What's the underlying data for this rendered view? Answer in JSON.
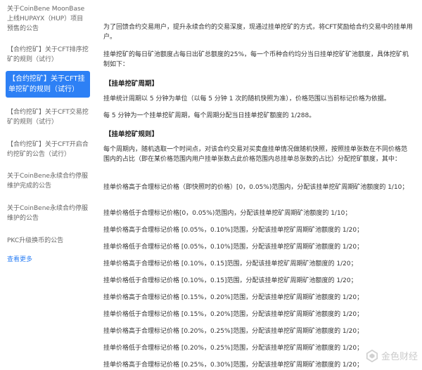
{
  "sidebar": {
    "items": [
      {
        "label": "关于CoinBene MoonBase上线HUPAYX（HUP）项目预售的公告"
      },
      {
        "label": "【合约挖矿】关于CFT排序挖矿的规则（试行）"
      },
      {
        "label": "【合约挖矿】关于CFT挂单挖矿的规则（试行）"
      },
      {
        "label": "【合约挖矿】关于CFT交易挖矿的规则（试行）"
      },
      {
        "label": "【合约挖矿】关于CFT开启合约挖矿的公告（试行）"
      },
      {
        "label": "关于CoinBene永续合约停服维护完成的公告"
      },
      {
        "label": "关于CoinBene永续合约停服维护的公告"
      },
      {
        "label": "PKC升级换币的公告"
      }
    ],
    "see_more": "查看更多"
  },
  "article": {
    "intro1": "为了回馈合约交易用户，提升永续合约的交易深度，现通过挂单挖矿的方式，将CFT奖励给合约交易中的挂单用户。",
    "intro2": "挂单挖矿的每日矿池额度占每日出矿总额度的25%，每一个币种合约均分当日挂单挖矿矿池额度，具体挖矿机制如下：",
    "section1_title": "【挂单挖矿周期】",
    "cycle1": "挂单统计周期以 5 分钟为单位（以每 5 分钟 1 次的随机快照为准），价格范围以当前标记价格为依据。",
    "cycle2": "每 5 分钟为一个挂单挖矿周期，每个周期分配当日挂单挖矿额度的 1/288。",
    "section2_title": "【挂单挖矿规则】",
    "rules_intro": "每个周期内，随机选取一个时间点，对该合约交易对买卖盘挂单情况做随机快照，按照挂单张数在不同价格范围内的占比（即在某价格范围内用户挂单张数占此价格范围内总挂单总张数的占比）分配挖矿额度，其中：",
    "rule_first": "挂单价格高于合理标记价格（即快照时的价格）[0，0.05%)范围内，分配该挂单挖矿周期矿池额度的 1/10；",
    "rules": [
      "挂单价格低于合理标记价格[0，0.05%)范围内，分配该挂单挖矿周期矿池额度的 1/10；",
      "挂单价格高于合理标记价格 [0.05%，0.10%]范围，分配该挂单挖矿周期矿池额度的 1/20；",
      "挂单价格低于合理标记价格 [0.05%，0.10%]范围，分配该挂单挖矿周期矿池额度的 1/20；",
      "挂单价格高于合理标记价格 [0.10%，0.15]范围，分配该挂单挖矿周期矿池额度的 1/20；",
      "挂单价格低于合理标记价格 [0.10%，0.15]范围，分配该挂单挖矿周期矿池额度的 1/20；",
      "挂单价格高于合理标记价格 [0.15%，0.20%]范围，分配该挂单挖矿周期矿池额度的 1/20；",
      "挂单价格低于合理标记价格 [0.15%，0.20%]范围，分配该挂单挖矿周期矿池额度的 1/20；",
      "挂单价格高于合理标记价格 [0.20%，0.25%]范围，分配该挂单挖矿周期矿池额度的 1/20；",
      "挂单价格低于合理标记价格 [0.20%，0.25%]范围，分配该挂单挖矿周期矿池额度的 1/20；",
      "挂单价格高于合理标记价格 [0.25%，0.30%]范围，分配该挂单挖矿周期矿池额度的 1/20；"
    ]
  },
  "watermark": {
    "text": "金色财经"
  }
}
